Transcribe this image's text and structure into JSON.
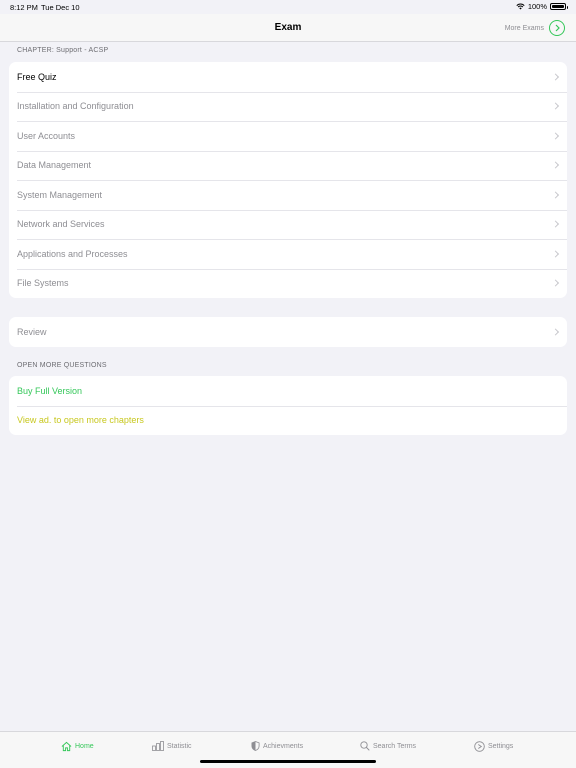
{
  "status_bar": {
    "time": "8:12 PM",
    "date": "Tue Dec 10",
    "battery": "100%"
  },
  "nav": {
    "title": "Exam",
    "more_exams": "More Exams"
  },
  "chapter_section": {
    "header": "CHAPTER: Support - ACSP",
    "items": [
      {
        "label": "Free Quiz"
      },
      {
        "label": "Installation and Configuration"
      },
      {
        "label": "User Accounts"
      },
      {
        "label": "Data Management"
      },
      {
        "label": "System Management"
      },
      {
        "label": "Network and Services"
      },
      {
        "label": "Applications and Processes"
      },
      {
        "label": "File Systems"
      }
    ]
  },
  "review_section": {
    "items": [
      {
        "label": "Review"
      }
    ]
  },
  "open_more_section": {
    "header": "OPEN MORE QUESTIONS",
    "items": [
      {
        "label": "Buy Full Version"
      },
      {
        "label": "View ad. to open more chapters"
      }
    ]
  },
  "tab_bar": {
    "tabs": [
      {
        "label": "Home",
        "icon": "house-icon"
      },
      {
        "label": "Statistic",
        "icon": "bar-chart-icon"
      },
      {
        "label": "Achievments",
        "icon": "shield-icon"
      },
      {
        "label": "Search Terms",
        "icon": "magnifier-icon"
      },
      {
        "label": "Settings",
        "icon": "play-circle-icon"
      }
    ]
  },
  "colors": {
    "accent_green": "#34c759",
    "accent_yellow": "#c8c820",
    "secondary_text": "#8e8e93",
    "background": "#f2f2f7"
  }
}
